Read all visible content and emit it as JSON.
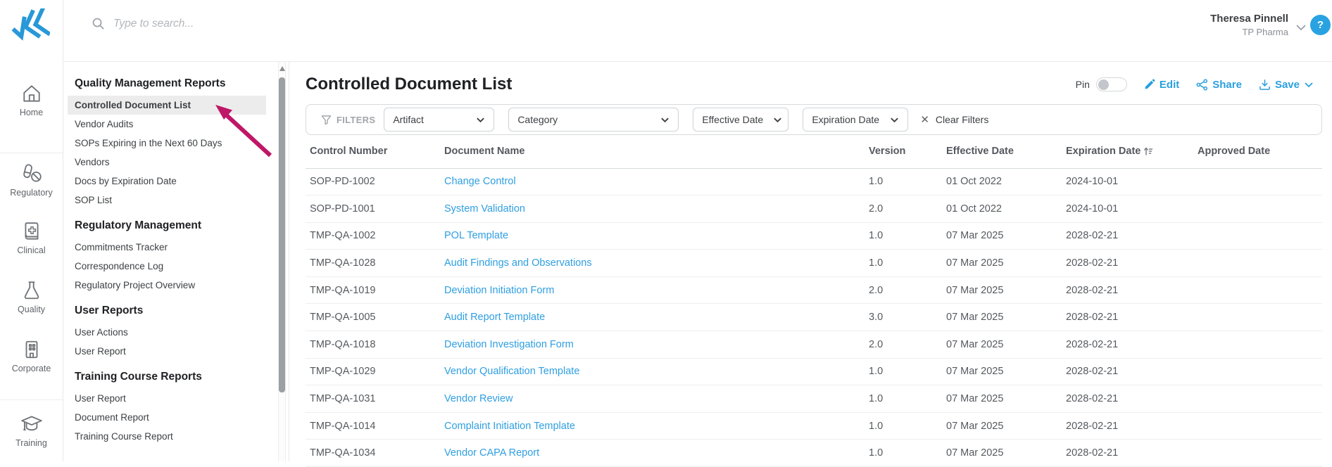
{
  "colors": {
    "accent_blue": "#2a9fdf",
    "logo_blue": "#2898d8",
    "help_blue": "#29a2e1",
    "annotation_arrow": "#bf1767",
    "selected_item_bg": "#ececec"
  },
  "header": {
    "search_placeholder": "Type to search...",
    "user_name": "Theresa Pinnell",
    "user_org": "TP Pharma",
    "help_label": "?"
  },
  "rail": {
    "items": [
      {
        "label": "Home",
        "icon": "home-icon"
      },
      {
        "label": "Regulatory",
        "icon": "pills-icon"
      },
      {
        "label": "Clinical",
        "icon": "medical-book-icon"
      },
      {
        "label": "Quality",
        "icon": "flask-icon"
      },
      {
        "label": "Corporate",
        "icon": "building-icon"
      },
      {
        "label": "Training",
        "icon": "graduation-cap-icon"
      }
    ]
  },
  "sidebar": {
    "sections": [
      {
        "title": "Quality Management Reports",
        "items": [
          {
            "label": "Controlled Document List",
            "selected": true
          },
          {
            "label": "Vendor Audits",
            "selected": false
          },
          {
            "label": "SOPs Expiring in the Next 60 Days",
            "selected": false
          },
          {
            "label": "Vendors",
            "selected": false
          },
          {
            "label": "Docs by Expiration Date",
            "selected": false
          },
          {
            "label": "SOP List",
            "selected": false
          }
        ]
      },
      {
        "title": "Regulatory Management",
        "items": [
          {
            "label": "Commitments Tracker",
            "selected": false
          },
          {
            "label": "Correspondence Log",
            "selected": false
          },
          {
            "label": "Regulatory Project Overview",
            "selected": false
          }
        ]
      },
      {
        "title": "User Reports",
        "items": [
          {
            "label": "User Actions",
            "selected": false
          },
          {
            "label": "User Report",
            "selected": false
          }
        ]
      },
      {
        "title": "Training Course Reports",
        "items": [
          {
            "label": "User Report",
            "selected": false
          },
          {
            "label": "Document Report",
            "selected": false
          },
          {
            "label": "Training Course Report",
            "selected": false
          }
        ]
      }
    ]
  },
  "main": {
    "title": "Controlled Document List",
    "actions": {
      "pin_label": "Pin",
      "pin_on": false,
      "edit_label": "Edit",
      "share_label": "Share",
      "save_label": "Save"
    },
    "filters": {
      "filters_label": "FILTERS",
      "artifact_label": "Artifact",
      "category_label": "Category",
      "effective_date_label": "Effective Date",
      "expiration_date_label": "Expiration Date",
      "clear_label": "Clear Filters"
    },
    "table": {
      "columns": [
        "Control Number",
        "Document Name",
        "Version",
        "Effective Date",
        "Expiration Date",
        "Approved Date"
      ],
      "sorted_column": "Expiration Date",
      "sort_direction": "asc",
      "rows": [
        [
          "SOP-PD-1002",
          "Change Control",
          "1.0",
          "01 Oct 2022",
          "2024-10-01",
          ""
        ],
        [
          "SOP-PD-1001",
          "System Validation",
          "2.0",
          "01 Oct 2022",
          "2024-10-01",
          ""
        ],
        [
          "TMP-QA-1002",
          "POL Template",
          "1.0",
          "07 Mar 2025",
          "2028-02-21",
          ""
        ],
        [
          "TMP-QA-1028",
          "Audit Findings and Observations",
          "1.0",
          "07 Mar 2025",
          "2028-02-21",
          ""
        ],
        [
          "TMP-QA-1019",
          "Deviation Initiation Form",
          "2.0",
          "07 Mar 2025",
          "2028-02-21",
          ""
        ],
        [
          "TMP-QA-1005",
          "Audit Report Template",
          "3.0",
          "07 Mar 2025",
          "2028-02-21",
          ""
        ],
        [
          "TMP-QA-1018",
          "Deviation Investigation Form",
          "2.0",
          "07 Mar 2025",
          "2028-02-21",
          ""
        ],
        [
          "TMP-QA-1029",
          "Vendor Qualification Template",
          "1.0",
          "07 Mar 2025",
          "2028-02-21",
          ""
        ],
        [
          "TMP-QA-1031",
          "Vendor Review",
          "1.0",
          "07 Mar 2025",
          "2028-02-21",
          ""
        ],
        [
          "TMP-QA-1014",
          "Complaint Initiation Template",
          "1.0",
          "07 Mar 2025",
          "2028-02-21",
          ""
        ],
        [
          "TMP-QA-1034",
          "Vendor CAPA Report",
          "1.0",
          "07 Mar 2025",
          "2028-02-21",
          ""
        ]
      ]
    }
  }
}
